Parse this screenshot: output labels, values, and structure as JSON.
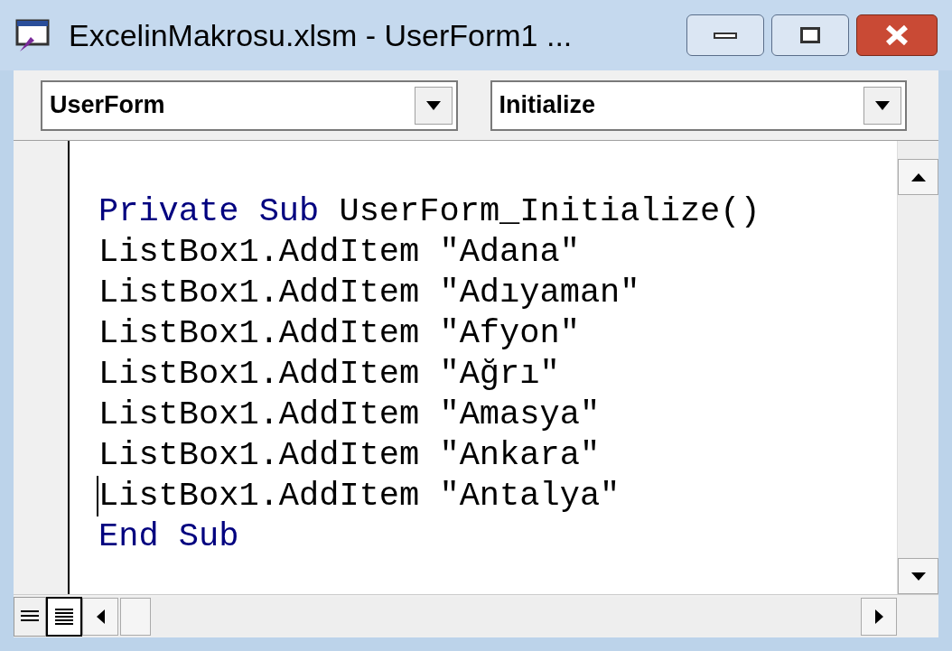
{
  "window": {
    "title": "ExcelinMakrosu.xlsm - UserForm1 ..."
  },
  "object_dropdown": {
    "value": "UserForm"
  },
  "procedure_dropdown": {
    "value": "Initialize"
  },
  "code_lines": [
    {
      "caret": false,
      "segments": [
        {
          "kind": "keyword",
          "text": "Private Sub"
        },
        {
          "kind": "plain",
          "text": " UserForm_Initialize()"
        }
      ]
    },
    {
      "caret": false,
      "segments": [
        {
          "kind": "plain",
          "text": "ListBox1.AddItem \"Adana\""
        }
      ]
    },
    {
      "caret": false,
      "segments": [
        {
          "kind": "plain",
          "text": "ListBox1.AddItem \"Adıyaman\""
        }
      ]
    },
    {
      "caret": false,
      "segments": [
        {
          "kind": "plain",
          "text": "ListBox1.AddItem \"Afyon\""
        }
      ]
    },
    {
      "caret": false,
      "segments": [
        {
          "kind": "plain",
          "text": "ListBox1.AddItem \"Ağrı\""
        }
      ]
    },
    {
      "caret": false,
      "segments": [
        {
          "kind": "plain",
          "text": "ListBox1.AddItem \"Amasya\""
        }
      ]
    },
    {
      "caret": false,
      "segments": [
        {
          "kind": "plain",
          "text": "ListBox1.AddItem \"Ankara\""
        }
      ]
    },
    {
      "caret": true,
      "segments": [
        {
          "kind": "plain",
          "text": "ListBox1.AddItem \"Antalya\""
        }
      ]
    },
    {
      "caret": false,
      "segments": [
        {
          "kind": "keyword",
          "text": "End Sub"
        }
      ]
    }
  ]
}
